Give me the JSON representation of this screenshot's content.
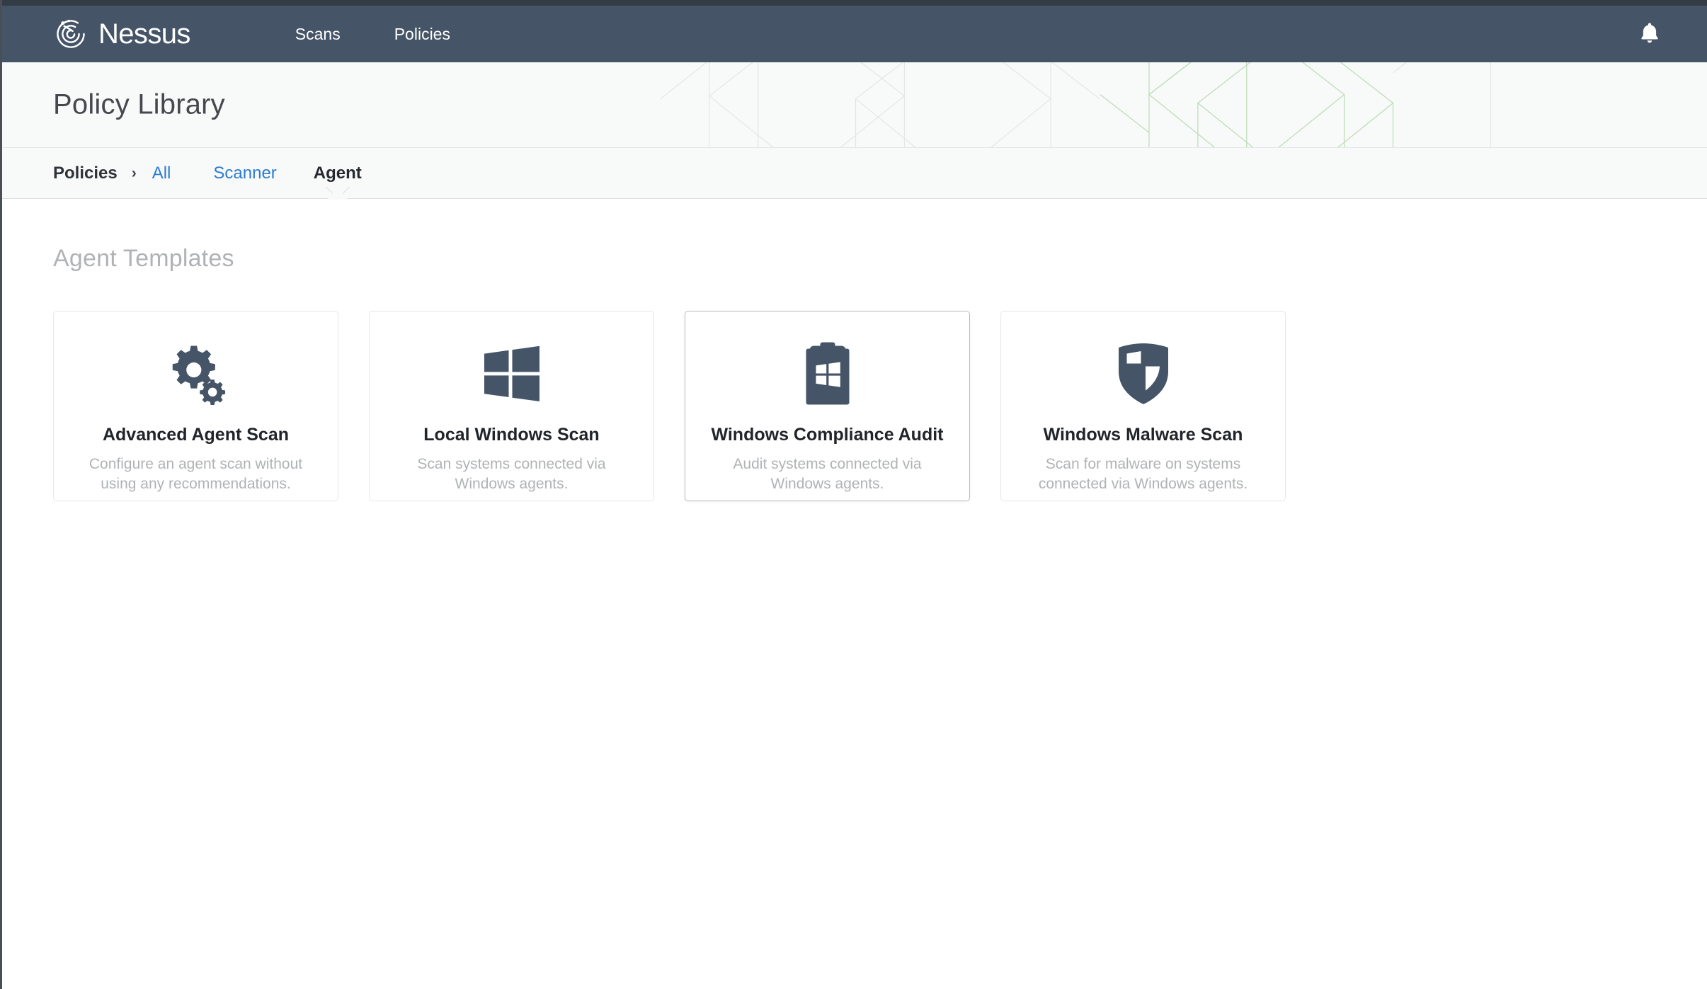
{
  "colors": {
    "navbar_bg": "#455567",
    "top_strip": "#333b45",
    "header_bg": "#f8f9f9",
    "link_blue": "#2e7bd1",
    "icon_slate": "#455567",
    "muted_gray": "#b0b3b5",
    "pattern_gray": "#e4e6e6",
    "pattern_green": "#bcdcb4",
    "card_border": "#e6e7e8",
    "card_border_hover": "#b9bcbf"
  },
  "navbar": {
    "brand": "Nessus",
    "brand_icon": "nessus-spiral-logo",
    "links": [
      {
        "label": "Scans"
      },
      {
        "label": "Policies"
      }
    ],
    "notifications_icon": "bell-icon"
  },
  "header": {
    "title": "Policy Library"
  },
  "breadcrumb": {
    "root": "Policies",
    "separator": "›",
    "tabs": [
      {
        "label": "All",
        "active": false
      },
      {
        "label": "Scanner",
        "active": false
      },
      {
        "label": "Agent",
        "active": true
      }
    ]
  },
  "main": {
    "section_title": "Agent Templates",
    "templates": [
      {
        "title": "Advanced Agent Scan",
        "description": "Configure an agent scan without\nusing any recommendations.",
        "icon": "gears-icon",
        "hover": false
      },
      {
        "title": "Local Windows Scan",
        "description": "Scan systems connected via\nWindows agents.",
        "icon": "windows-logo-icon",
        "hover": false
      },
      {
        "title": "Windows Compliance Audit",
        "description": "Audit systems connected via\nWindows agents.",
        "icon": "clipboard-windows-icon",
        "hover": true
      },
      {
        "title": "Windows Malware Scan",
        "description": "Scan for malware on systems\nconnected via Windows agents.",
        "icon": "shield-icon",
        "hover": false
      }
    ]
  }
}
